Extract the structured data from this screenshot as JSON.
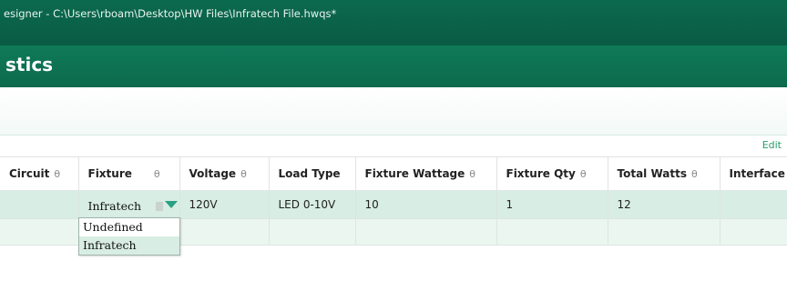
{
  "window": {
    "title": "esigner - C:\\Users\\rboam\\Desktop\\HW Files\\Infratech File.hwqs*"
  },
  "header": {
    "heading": "stics"
  },
  "toolbar": {
    "edit_label": "Edit"
  },
  "table": {
    "columns": [
      "Circuit",
      "Fixture",
      "Voltage",
      "Load Type",
      "Fixture Wattage",
      "Fixture Qty",
      "Total Watts",
      "Interface"
    ],
    "sortable": [
      true,
      true,
      true,
      false,
      true,
      true,
      true,
      false
    ],
    "rows": [
      {
        "circuit": "",
        "fixture": "Infratech",
        "voltage": "120V",
        "load_type": "LED 0-10V",
        "fixture_wattage": "10",
        "fixture_qty": "1",
        "total_watts": "12",
        "interface": ""
      }
    ]
  },
  "fixture_dropdown": {
    "selected": "Infratech",
    "options": [
      "Undefined",
      "Infratech"
    ]
  },
  "colors": {
    "titlebar": "#0a5b43",
    "header": "#0f7a58",
    "row_selected": "#d8ede4",
    "dropdown_arrow": "#2aa083",
    "edit_link": "#2a9c6d"
  },
  "icons": {
    "sort": "sort-icon",
    "dropdown": "chevron-down-icon"
  }
}
